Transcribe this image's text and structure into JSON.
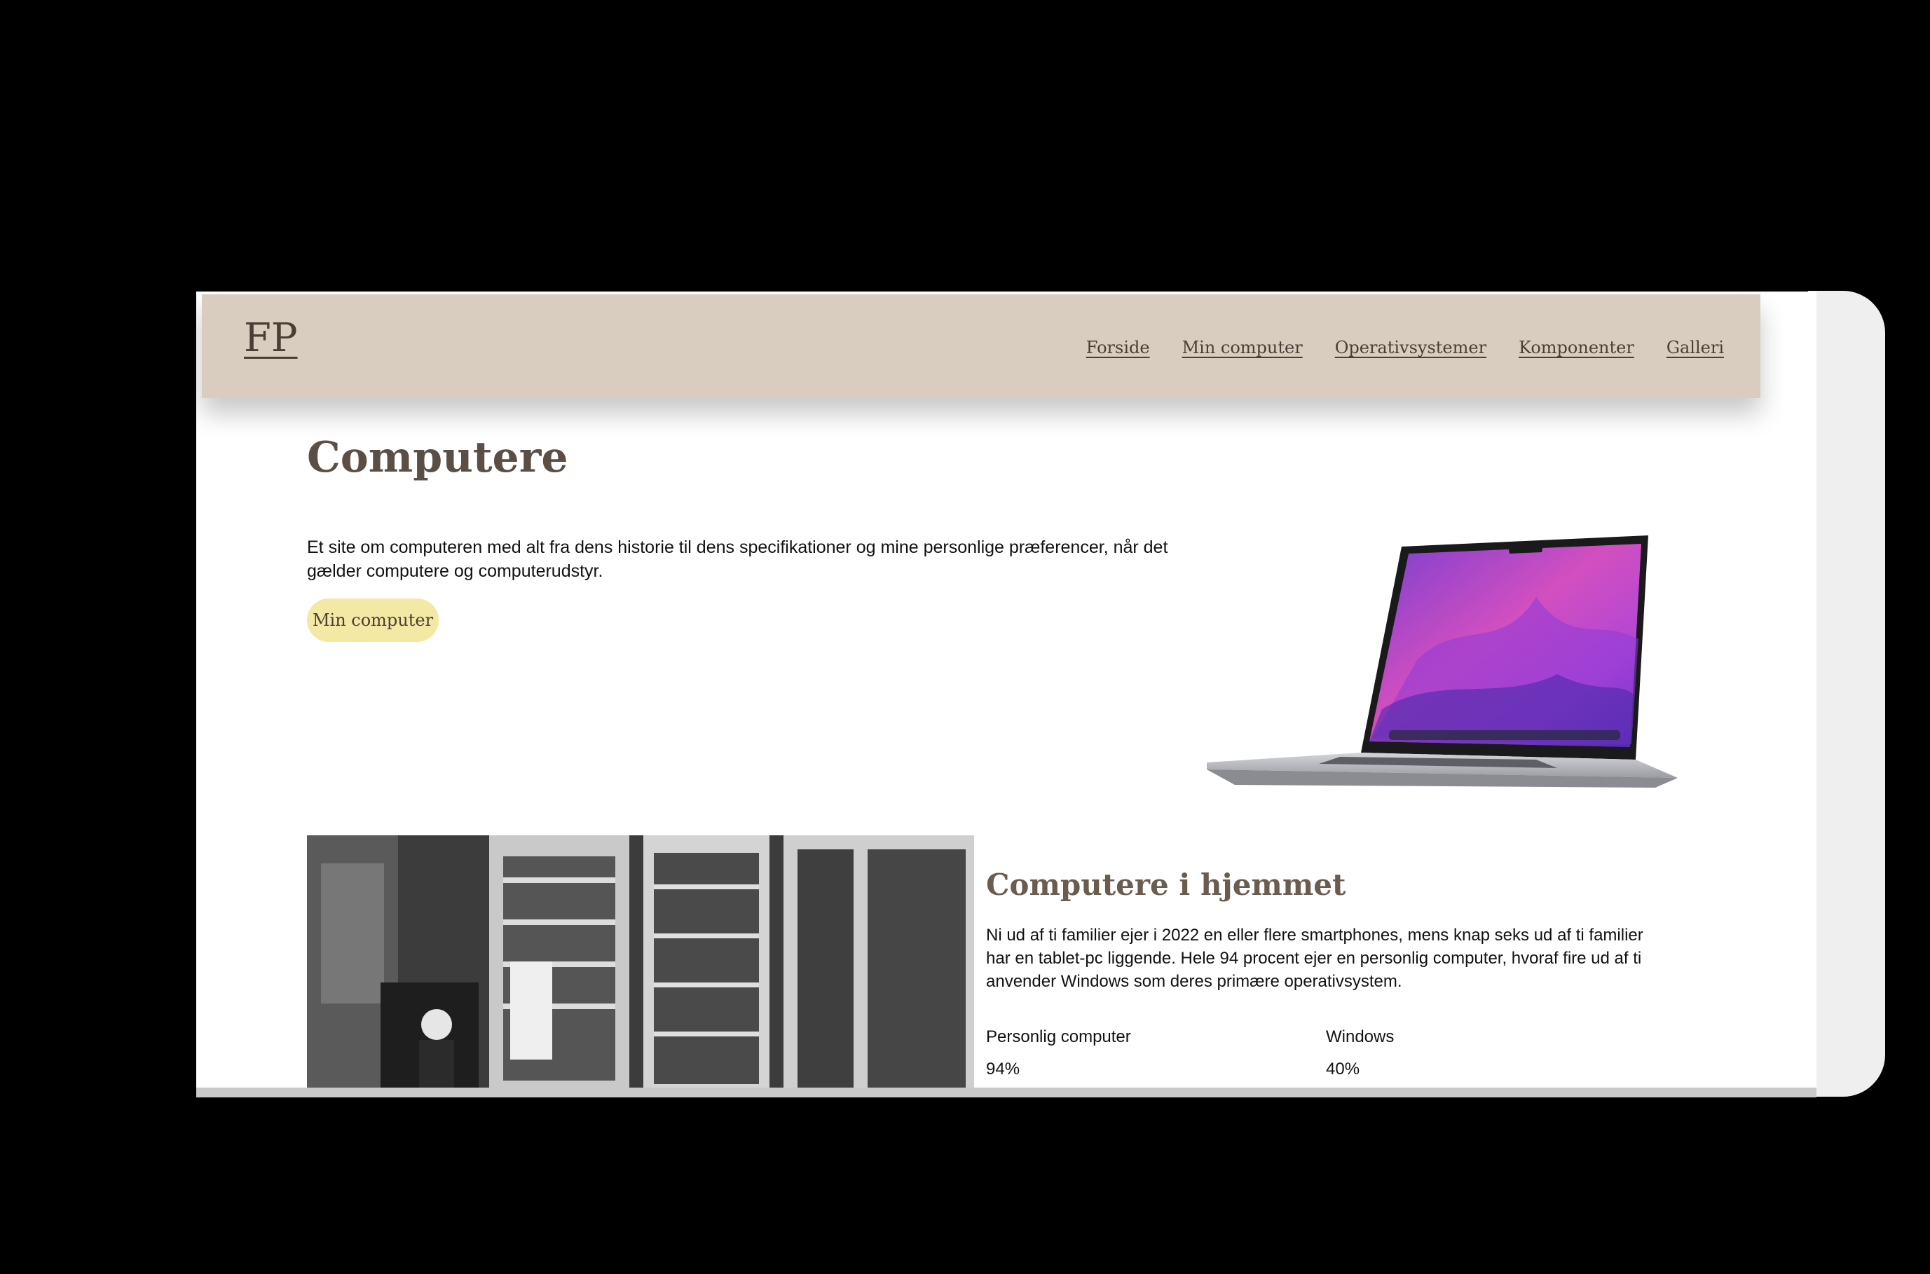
{
  "header": {
    "logo": "FP",
    "nav": [
      {
        "label": "Forside"
      },
      {
        "label": "Min computer"
      },
      {
        "label": "Operativsystemer"
      },
      {
        "label": "Komponenter"
      },
      {
        "label": "Galleri"
      }
    ]
  },
  "hero": {
    "title": "Computere",
    "intro": "Et site om computeren med alt fra dens historie til dens specifikationer og mine personlige præferencer, når det gælder computere og computerudstyr.",
    "button_label": "Min computer"
  },
  "section": {
    "title": "Computere i hjemmet",
    "text": "Ni ud af ti familier ejer i 2022 en eller flere smartphones, mens knap seks ud af ti familier har en tablet-pc liggende. Hele 94 procent ejer en personlig computer, hvoraf fire ud af ti anvender Windows som deres primære operativsystem.",
    "stats": [
      {
        "label": "Personlig computer",
        "value": "94%"
      },
      {
        "label": "Windows",
        "value": "40%"
      }
    ]
  },
  "colors": {
    "header_bg": "#d9cdbf",
    "button_bg": "#f3e9a4",
    "heading": "#5b4f45",
    "page_bg": "#ffffff",
    "backdrop": "#000000"
  }
}
